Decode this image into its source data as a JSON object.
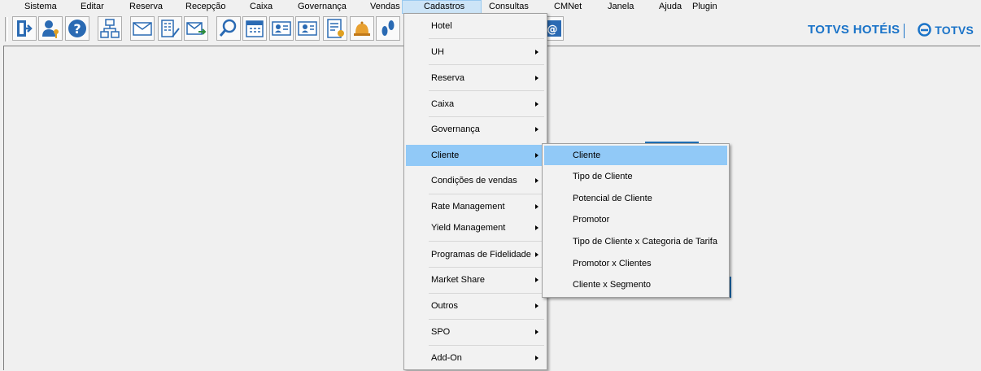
{
  "menubar": {
    "items": [
      "Sistema",
      "Editar",
      "Reserva",
      "Recepção",
      "Caixa",
      "Governança",
      "Vendas",
      "Cadastros",
      "Consultas",
      "CMNet",
      "Janela",
      "Ajuda",
      "Plugin"
    ],
    "open_item": "Cadastros"
  },
  "toolbar": {
    "icons": [
      "exit-icon",
      "user-key-icon",
      "help-icon",
      "org-chart-icon",
      "mail-icon",
      "building-icon",
      "mail-forward-icon",
      "search-icon",
      "calendar-icon",
      "id-card-icon",
      "id-card-2-icon",
      "guest-list-icon",
      "bell-icon",
      "footprints-icon",
      "email-at-icon"
    ]
  },
  "brand": {
    "product": "TOTVS HOTÉIS",
    "company": "TOTVS",
    "color": "#1a73c8"
  },
  "cadastros_menu": {
    "items": [
      {
        "label": "Hotel",
        "submenu": false
      },
      {
        "label": "UH",
        "submenu": true
      },
      {
        "label": "Reserva",
        "submenu": true
      },
      {
        "label": "Caixa",
        "submenu": true
      },
      {
        "label": "Governança",
        "submenu": true
      },
      {
        "label": "Cliente",
        "submenu": true,
        "highlighted": true
      },
      {
        "label": "Condições de vendas",
        "submenu": true
      },
      {
        "label": "Rate Management",
        "submenu": true
      },
      {
        "label": "Yield Management",
        "submenu": true
      },
      {
        "label": "Programas de Fidelidade",
        "submenu": true
      },
      {
        "label": "Market Share",
        "submenu": true
      },
      {
        "label": "Outros",
        "submenu": true
      },
      {
        "label": "SPO",
        "submenu": true
      },
      {
        "label": "Add-On",
        "submenu": true
      }
    ]
  },
  "cliente_submenu": {
    "items": [
      {
        "label": "Cliente",
        "highlighted": true
      },
      {
        "label": "Tipo de Cliente"
      },
      {
        "label": "Potencial de Cliente"
      },
      {
        "label": "Promotor"
      },
      {
        "label": "Tipo de Cliente x Categoria de Tarifa"
      },
      {
        "label": "Promotor x Clientes"
      },
      {
        "label": "Cliente x Segmento"
      }
    ]
  },
  "colors": {
    "highlight": "#91c9f7",
    "open_menu_bg": "#cce4f7",
    "accent": "#1a73c8"
  }
}
